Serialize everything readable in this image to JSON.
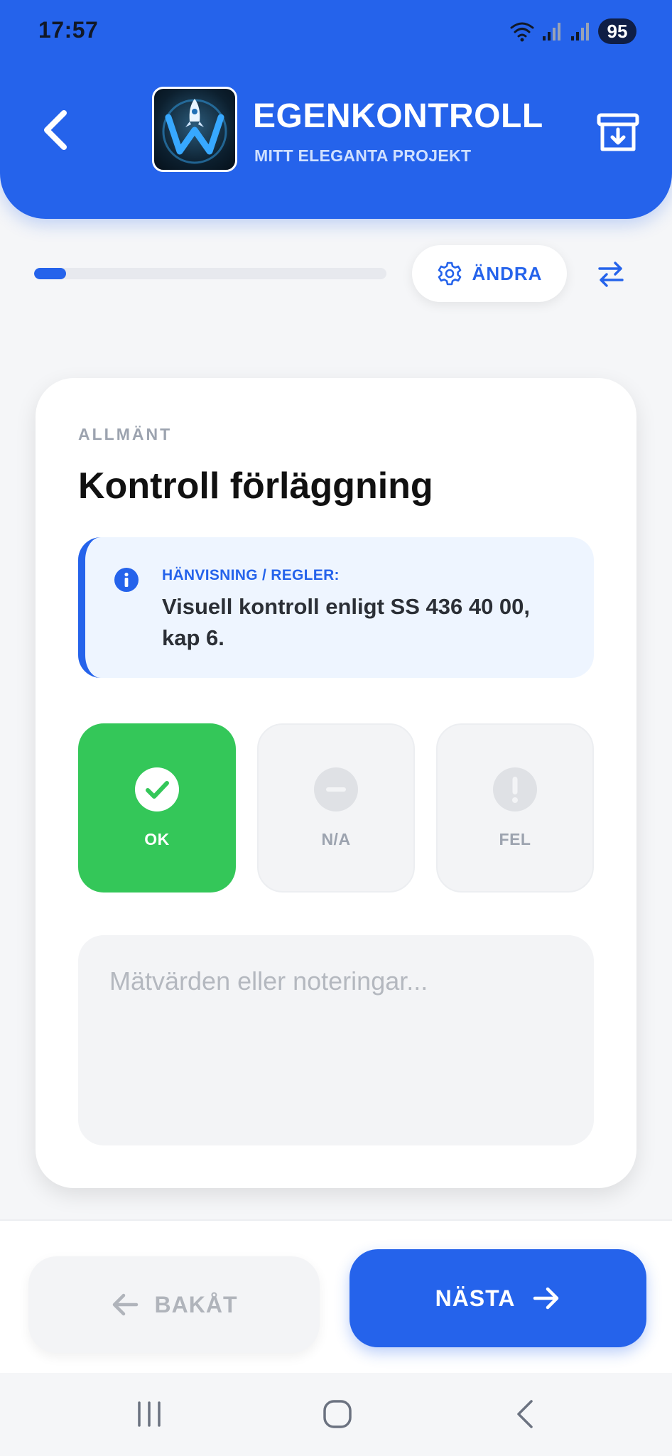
{
  "status_bar": {
    "time": "17:57",
    "battery": "95",
    "icons": [
      "wifi-icon",
      "signal-icon",
      "signal-icon",
      "battery-icon"
    ]
  },
  "header": {
    "title": "EGENKONTROLL",
    "subtitle": "MITT ELEGANTA PROJEKT",
    "back_icon": "chevron-left-icon",
    "archive_icon": "archive-download-icon"
  },
  "progress": {
    "fraction": 0.09
  },
  "toolbar": {
    "change_label": "ÄNDRA",
    "change_icon": "gear-icon",
    "swap_icon": "swap-arrows-icon"
  },
  "card": {
    "category": "ALLMÄNT",
    "title": "Kontroll förläggning",
    "info": {
      "heading": "HÄNVISNING / REGLER:",
      "text": "Visuell kontroll enligt SS 436 40 00, kap 6."
    },
    "options": [
      {
        "label": "OK",
        "selected": true,
        "icon": "check-circle-icon",
        "color": "#34c759"
      },
      {
        "label": "N/A",
        "selected": false,
        "icon": "minus-circle-icon"
      },
      {
        "label": "FEL",
        "selected": false,
        "icon": "exclamation-circle-icon"
      }
    ],
    "notes": {
      "value": "",
      "placeholder": "Mätvärden eller noteringar..."
    }
  },
  "footer": {
    "back_label": "BAKÅT",
    "next_label": "NÄSTA"
  },
  "colors": {
    "accent": "#2563eb",
    "ok": "#34c759",
    "muted": "#9ca3af"
  }
}
